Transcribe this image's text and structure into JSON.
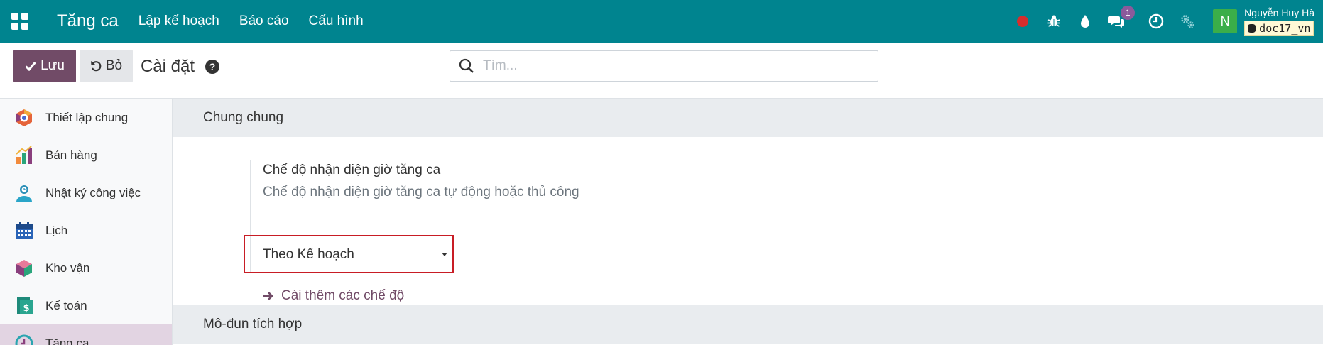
{
  "navbar": {
    "brand": "Tăng ca",
    "menu": [
      "Lập kế hoạch",
      "Báo cáo",
      "Cấu hình"
    ],
    "messages_count": "1",
    "avatar_letter": "N",
    "user_name": "Nguyễn Huy Hà",
    "database": "doc17_vn",
    "colors": {
      "bg": "#00848f",
      "record": "#d62d2d",
      "badge": "#8a5a9b",
      "avatar": "#3bae49"
    }
  },
  "control_panel": {
    "save_label": "Lưu",
    "discard_label": "Bỏ",
    "title": "Cài đặt",
    "search_placeholder": "Tìm..."
  },
  "sidebar": {
    "items": [
      {
        "label": "Thiết lập chung",
        "icon": "settings-app-icon"
      },
      {
        "label": "Bán hàng",
        "icon": "sales-app-icon"
      },
      {
        "label": "Nhật ký công việc",
        "icon": "timesheet-app-icon"
      },
      {
        "label": "Lịch",
        "icon": "calendar-app-icon"
      },
      {
        "label": "Kho vận",
        "icon": "inventory-app-icon"
      },
      {
        "label": "Kế toán",
        "icon": "accounting-app-icon"
      },
      {
        "label": "Tăng ca",
        "icon": "overtime-app-icon",
        "active": true
      }
    ]
  },
  "main": {
    "section1_title": "Chung chung",
    "setting": {
      "label": "Chế độ nhận diện giờ tăng ca",
      "description": "Chế độ nhận diện giờ tăng ca tự động hoặc thủ công",
      "selected_value": "Theo Kế hoạch",
      "more_link": "Cài thêm các chế độ"
    },
    "section2_title": "Mô-đun tích hợp"
  },
  "colors": {
    "primary": "#714b67",
    "highlight_border": "#c81d25"
  }
}
